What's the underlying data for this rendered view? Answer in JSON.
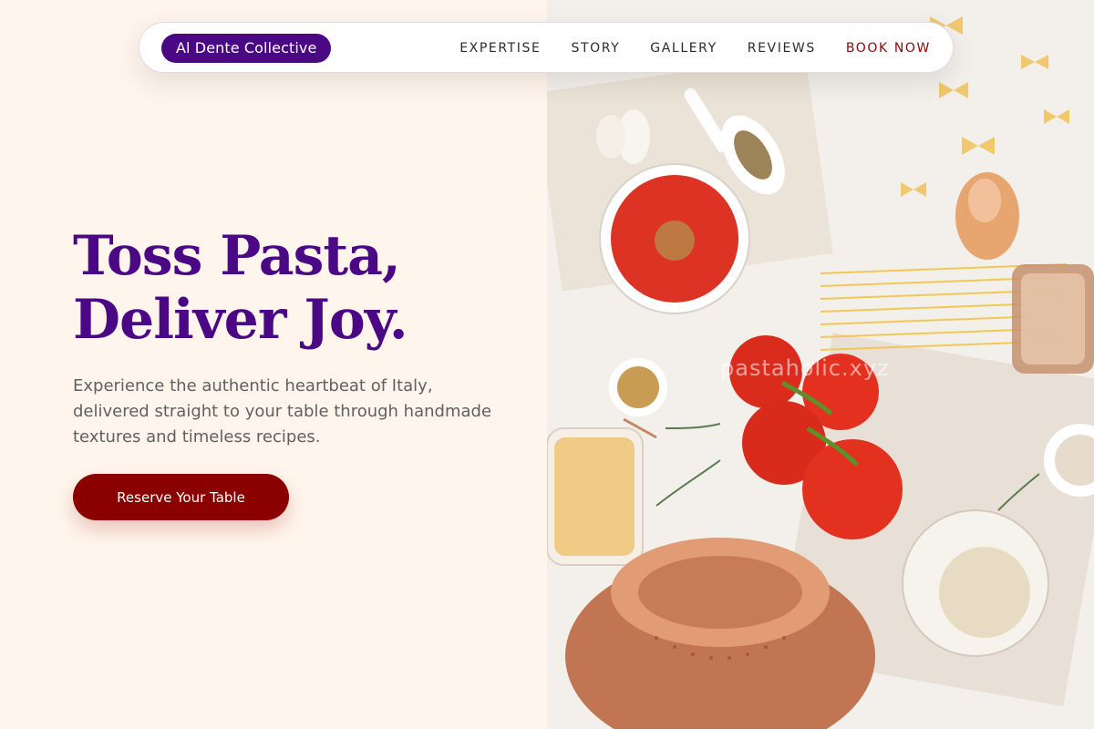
{
  "brand": {
    "name": "Al Dente Collective"
  },
  "nav": {
    "items": [
      "EXPERTISE",
      "STORY",
      "GALLERY",
      "REVIEWS"
    ],
    "cta": "BOOK NOW"
  },
  "hero": {
    "title_line1": "Toss Pasta,",
    "title_line2": "Deliver Joy.",
    "copy": "Experience the authentic heartbeat of Italy, delivered straight to your table through handmade textures and timeless recipes.",
    "button": "Reserve Your Table",
    "image_watermark": "pastaholic.xyz"
  },
  "colors": {
    "brand_purple": "#4b0885",
    "accent_red": "#8b0000",
    "background_cream": "#fff5ec"
  }
}
